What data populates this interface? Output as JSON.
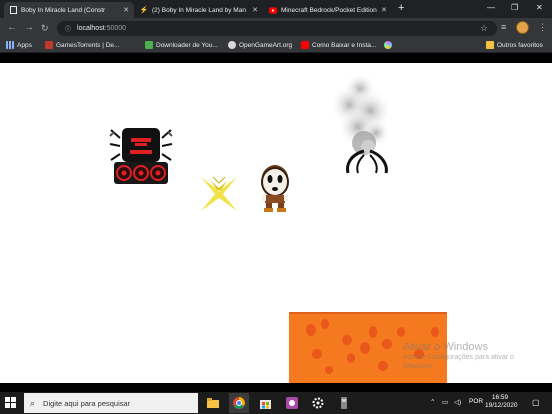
{
  "browser": {
    "tabs": [
      {
        "title": "Boby In Miracle Land (Constr",
        "active": true,
        "icon": "page-icon"
      },
      {
        "title": "(2) Boby In Miracle Land by Man",
        "active": false,
        "icon": "lightning-icon"
      },
      {
        "title": "Minecraft Bedrock/Pocket Edition",
        "active": false,
        "icon": "youtube-icon"
      }
    ],
    "new_tab_label": "+",
    "window_controls": {
      "minimize": "—",
      "maximize": "❐",
      "close": "✕"
    },
    "address": {
      "host": "localhost",
      "port": ":50000"
    },
    "bookmarks": [
      {
        "label": "Apps",
        "icon": "apps-grid-icon",
        "color": "#8ab4f8"
      },
      {
        "label": "GamesTorrents | De...",
        "icon": "gamestorrents-icon",
        "color": "#c0392b"
      },
      {
        "label": "Downloader de You...",
        "icon": "download-icon",
        "color": "#4caf50"
      },
      {
        "label": "OpenGameArt.org",
        "icon": "opengameart-icon",
        "color": "#d8d8d8"
      },
      {
        "label": "Como Baixar e Insta...",
        "icon": "youtube-icon",
        "color": "#ff0000"
      },
      {
        "label": "",
        "icon": "pinwheel-icon",
        "color": "#e066ff"
      },
      {
        "label": "Outros favoritos",
        "icon": "folder-icon",
        "color": "#f6c243"
      }
    ]
  },
  "game": {
    "background": "#ffffff",
    "lava_color": "#f4791f"
  },
  "watermark": {
    "title": "Ativar o Windows",
    "subtitle": "Acesse Configurações para ativar o Windows."
  },
  "taskbar": {
    "search_placeholder": "Digite aqui para pesquisar",
    "language": "POR",
    "time": "16:59",
    "date": "19/12/2020",
    "apps": [
      "file-explorer-icon",
      "chrome-icon",
      "store-icon",
      "app-icon",
      "settings-icon",
      "app-icon"
    ]
  }
}
